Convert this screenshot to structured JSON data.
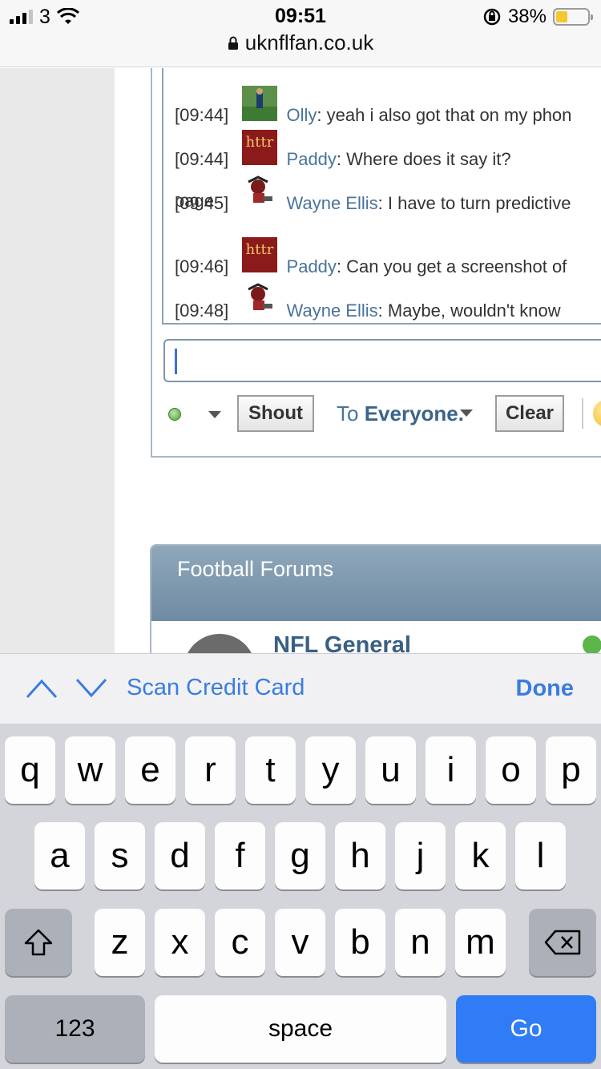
{
  "status": {
    "carrier": "3",
    "time": "09:51",
    "battery_percent": "38%",
    "battery_level": 0.38
  },
  "url": "uknflfan.co.uk",
  "shoutbox": {
    "messages": [
      {
        "time": "[09:44]",
        "user": "Olly",
        "text": ": yeah i also got that on my phon"
      },
      {
        "time": "[09:44]",
        "user": "Paddy",
        "text": ": Where does it say it?"
      },
      {
        "time": "[09:45]",
        "user": "Wayne Ellis",
        "text": ": I have to turn predictive"
      },
      {
        "time": "[09:46]",
        "user": "Paddy",
        "text": ": Can you get a screenshot of"
      },
      {
        "time": "[09:48]",
        "user": "Wayne Ellis",
        "text": ": Maybe, wouldn't know"
      }
    ],
    "wrap_text": "page",
    "shout_label": "Shout",
    "to_prefix": "To ",
    "to_target": "Everyone.",
    "clear_label": "Clear",
    "avatar_httr_text": "httr"
  },
  "forums": {
    "header": "Football Forums",
    "first_forum": "NFL General"
  },
  "accessory": {
    "scan_label": "Scan Credit Card",
    "done_label": "Done"
  },
  "keyboard": {
    "row1": [
      "q",
      "w",
      "e",
      "r",
      "t",
      "y",
      "u",
      "i",
      "o",
      "p"
    ],
    "row2": [
      "a",
      "s",
      "d",
      "f",
      "g",
      "h",
      "j",
      "k",
      "l"
    ],
    "row3": [
      "z",
      "x",
      "c",
      "v",
      "b",
      "n",
      "m"
    ],
    "numbers_label": "123",
    "space_label": "space",
    "go_label": "Go"
  },
  "colors": {
    "link_blue": "#49739b",
    "ios_blue": "#3a7ce0",
    "go_blue": "#2f7cf6"
  }
}
